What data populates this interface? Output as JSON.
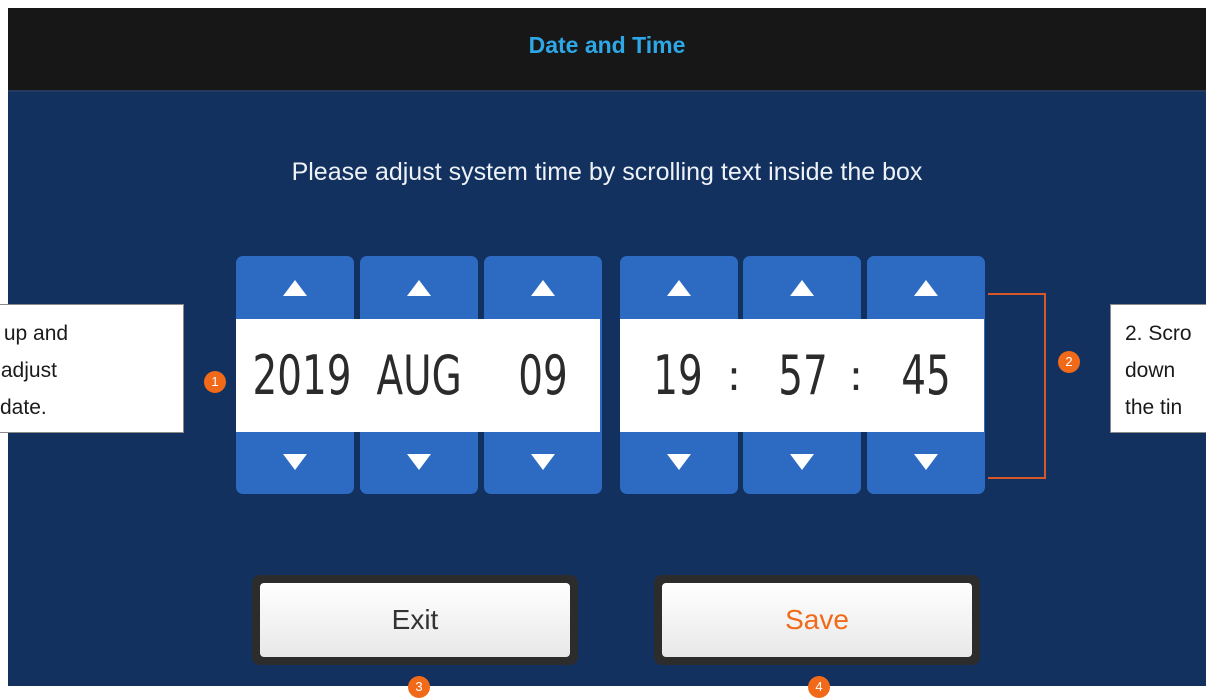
{
  "window": {
    "title": "Date and Time"
  },
  "instruction": "Please adjust system time by scrolling text inside the box",
  "date": {
    "year": "2019",
    "month": "AUG",
    "day": "09"
  },
  "time": {
    "hour": "19",
    "minute": "57",
    "second": "45",
    "separator": ":"
  },
  "buttons": {
    "exit_label": "Exit",
    "save_label": "Save"
  },
  "annotations": {
    "callout_left_lines": [
      "roll up and",
      "n to adjust",
      "date."
    ],
    "callout_right_lines": [
      "2. Scro",
      "down",
      "the tin"
    ],
    "markers": [
      "1",
      "2",
      "3",
      "4"
    ]
  },
  "icons": {
    "up": "triangle-up-icon",
    "down": "triangle-down-icon"
  },
  "colors": {
    "background": "#12315f",
    "titlebar": "#171717",
    "title_text": "#2ea7e6",
    "spinner_blue": "#2d6bc2",
    "save_text": "#f06a19",
    "marker_orange": "#f06a19",
    "bracket": "#d4582a"
  }
}
